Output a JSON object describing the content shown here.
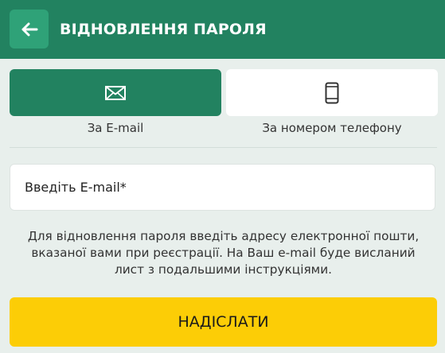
{
  "header": {
    "title": "ВІДНОВЛЕННЯ ПАРОЛЯ",
    "back_icon": "arrow-left-icon"
  },
  "colors": {
    "header_bg": "#228260",
    "back_button_bg": "#2fa278",
    "active_tab_bg": "#228260",
    "inactive_tab_bg": "#ffffff",
    "page_bg": "#e8efec",
    "submit_bg": "#fccd06"
  },
  "tabs": [
    {
      "label": "За E-mail",
      "icon": "envelope-icon",
      "active": true
    },
    {
      "label": "За номером телефону",
      "icon": "smartphone-icon",
      "active": false
    }
  ],
  "form": {
    "email_placeholder": "Введіть E-mail*",
    "email_value": ""
  },
  "info": {
    "lines": [
      "Для відновлення пароля введіть адресу електронної пошти,",
      "вказаної вами при реєстрації. На Ваш e-mail буде висланий",
      "лист з подальшими інструкціями."
    ]
  },
  "submit": {
    "label": "НАДІСЛАТИ"
  }
}
